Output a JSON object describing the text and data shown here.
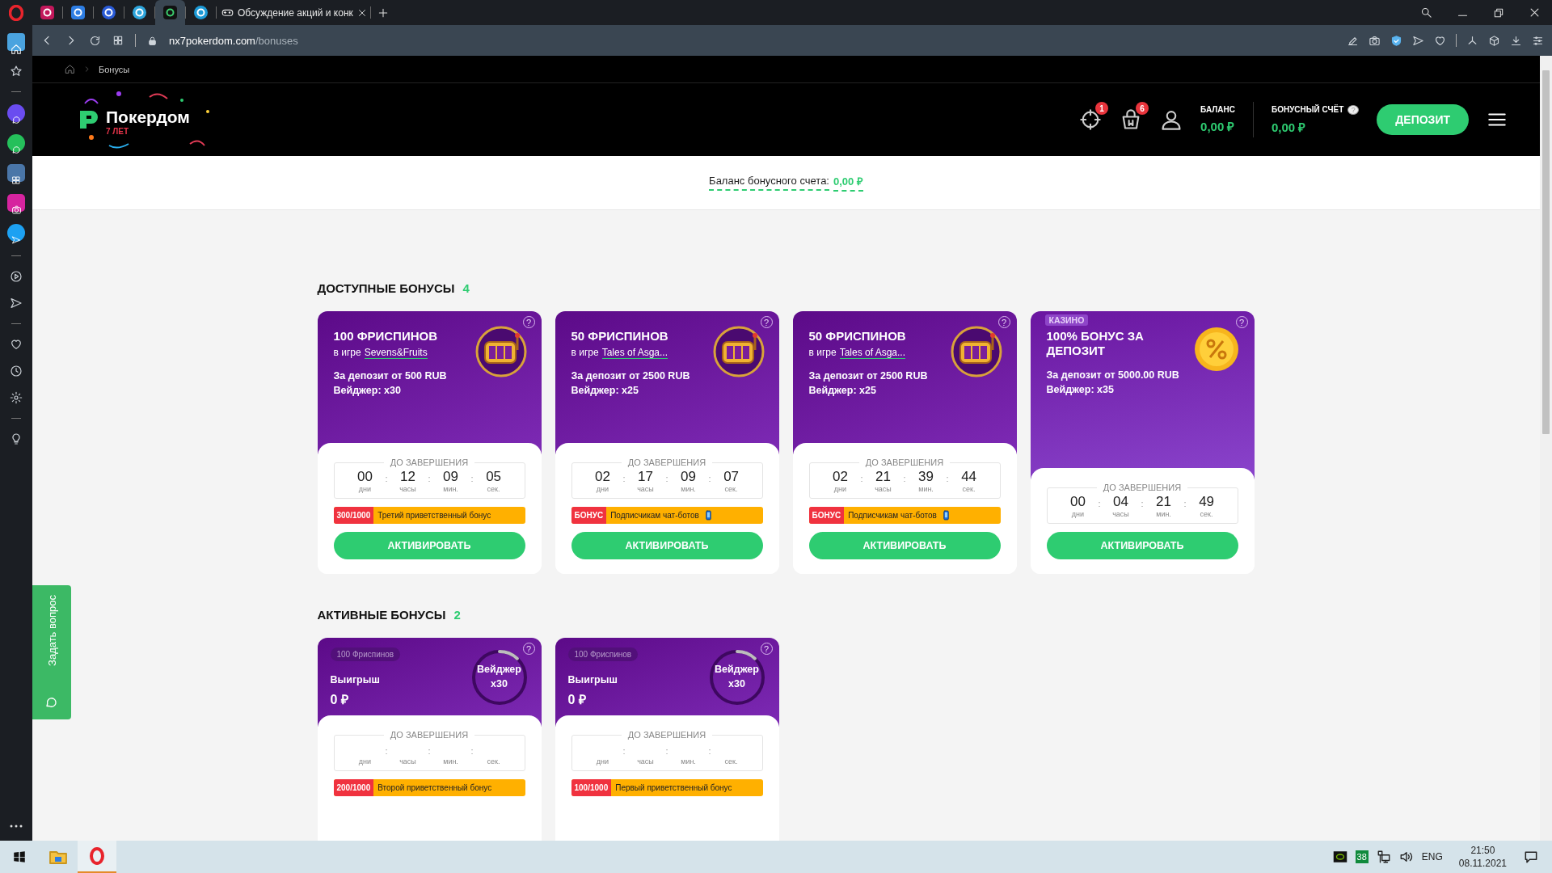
{
  "browser": {
    "tabs": [
      {
        "kind": "icon",
        "selected": false
      },
      {
        "kind": "icon",
        "selected": false
      },
      {
        "kind": "icon",
        "selected": false
      },
      {
        "kind": "icon",
        "selected": false
      },
      {
        "kind": "icon",
        "selected": true
      },
      {
        "kind": "icon",
        "selected": false
      },
      {
        "kind": "page",
        "selected": false,
        "title": "Обсуждение акций и конк"
      }
    ],
    "url_host": "nx7pokerdom.com",
    "url_path": "/bonuses"
  },
  "breadcrumb": "Бонусы",
  "header": {
    "logo": "Покердом",
    "logo_sub": "7 ЛЕТ",
    "notifications_badge": "1",
    "cart_badge": "6",
    "balance_label": "БАЛАНС",
    "balance": "0,00 ₽",
    "bonus_label": "БОНУСНЫЙ СЧЁТ",
    "bonus_help": "?",
    "bonus": "0,00 ₽",
    "deposit": "ДЕПОЗИТ"
  },
  "bonus_balance": {
    "label": "Баланс бонусного счета:",
    "value": "0,00 ₽"
  },
  "timer_separator": ":",
  "available": {
    "title": "ДОСТУПНЫЕ БОНУСЫ",
    "count": "4",
    "cards": [
      {
        "kind": "slot",
        "title": "100 ФРИСПИНОВ",
        "game_prefix": "в игре",
        "game": "Sevens&Fruits",
        "deposit": "За депозит **от 500 RUB**",
        "wager": "Вейджер: x30",
        "help": "?",
        "timer_label": "ДО ЗАВЕРШЕНИЯ",
        "timer": [
          {
            "value": "00",
            "unit": "дни"
          },
          {
            "value": "12",
            "unit": "часы"
          },
          {
            "value": "09",
            "unit": "мин."
          },
          {
            "value": "05",
            "unit": "сек."
          }
        ],
        "promo": {
          "kind": "welcome",
          "badge": "300/1000",
          "text": "Третий приветственный бонус"
        },
        "button": "АКТИВИРОВАТЬ"
      },
      {
        "kind": "slot",
        "title": "50 ФРИСПИНОВ",
        "game_prefix": "в игре",
        "game": "Tales of Asga...",
        "deposit": "За депозит **от 2500 RUB**",
        "wager": "Вейджер: x25",
        "help": "?",
        "timer_label": "ДО ЗАВЕРШЕНИЯ",
        "timer": [
          {
            "value": "02",
            "unit": "дни"
          },
          {
            "value": "17",
            "unit": "часы"
          },
          {
            "value": "09",
            "unit": "мин."
          },
          {
            "value": "07",
            "unit": "сек."
          }
        ],
        "promo": {
          "kind": "chatbot",
          "badge": "БОНУС",
          "text": "Подписчикам чат-ботов"
        },
        "button": "АКТИВИРОВАТЬ"
      },
      {
        "kind": "slot",
        "title": "50 ФРИСПИНОВ",
        "game_prefix": "в игре",
        "game": "Tales of Asga...",
        "deposit": "За депозит **от 2500 RUB**",
        "wager": "Вейджер: x25",
        "help": "?",
        "timer_label": "ДО ЗАВЕРШЕНИЯ",
        "timer": [
          {
            "value": "02",
            "unit": "дни"
          },
          {
            "value": "21",
            "unit": "часы"
          },
          {
            "value": "39",
            "unit": "мин."
          },
          {
            "value": "44",
            "unit": "сек."
          }
        ],
        "promo": {
          "kind": "chatbot",
          "badge": "БОНУС",
          "text": "Подписчикам чат-ботов"
        },
        "button": "АКТИВИРОВАТЬ"
      },
      {
        "kind": "deposit",
        "tag": "КАЗИНО",
        "title": "100% БОНУС ЗА ДЕПОЗИТ",
        "deposit": "За депозит **от 5000.00 RUB**",
        "wager": "Вейджер: x35",
        "help": "?",
        "timer_label": "ДО ЗАВЕРШЕНИЯ",
        "timer": [
          {
            "value": "00",
            "unit": "дни"
          },
          {
            "value": "04",
            "unit": "часы"
          },
          {
            "value": "21",
            "unit": "мин."
          },
          {
            "value": "49",
            "unit": "сек."
          }
        ],
        "button": "АКТИВИРОВАТЬ"
      }
    ]
  },
  "active": {
    "title": "АКТИВНЫЕ БОНУСЫ",
    "count": "2",
    "cards": [
      {
        "pill": "100 Фриспинов",
        "win_label": "Выигрыш",
        "win": "0 ₽",
        "wager_label": "Вейджер",
        "wager": "x30",
        "level": 0.12,
        "help": "?",
        "timer_label": "ДО ЗАВЕРШЕНИЯ",
        "timer": [
          {
            "unit": "дни"
          },
          {
            "unit": "часы"
          },
          {
            "unit": "мин."
          },
          {
            "unit": "сек."
          }
        ],
        "promo": {
          "kind": "welcome",
          "badge": "200/1000",
          "text": "Второй приветственный бонус"
        }
      },
      {
        "pill": "100 Фриспинов",
        "win_label": "Выигрыш",
        "win": "0 ₽",
        "wager_label": "Вейджер",
        "wager": "x30",
        "level": 0.12,
        "help": "?",
        "timer_label": "ДО ЗАВЕРШЕНИЯ",
        "timer": [
          {
            "unit": "дни"
          },
          {
            "unit": "часы"
          },
          {
            "unit": "мин."
          },
          {
            "unit": "сек."
          }
        ],
        "promo": {
          "kind": "welcome",
          "badge": "100/1000",
          "text": "Первый приветственный бонус"
        }
      }
    ]
  },
  "ask_question": "Задать вопрос",
  "taskbar": {
    "tray_badge": "38",
    "language": "ENG",
    "time": "21:50",
    "date": "08.11.2021"
  }
}
